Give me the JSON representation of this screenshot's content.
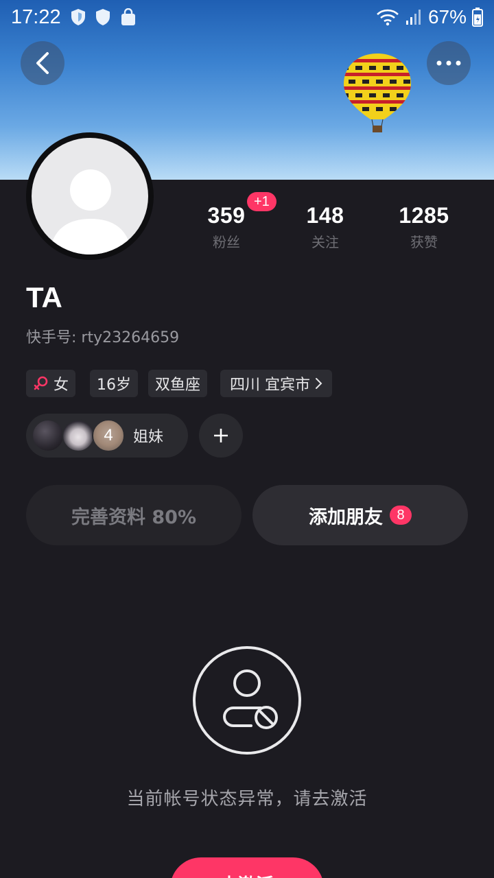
{
  "status_bar": {
    "time": "17:22",
    "battery_percent": "67%",
    "left_icons": [
      "shield-icon",
      "shield-icon",
      "shopping-bag-icon"
    ],
    "right_icons": [
      "wifi-icon",
      "signal-icon",
      "battery-icon"
    ]
  },
  "header": {
    "back_icon": "chevron-left-icon",
    "more_icon": "more-horizontal-icon"
  },
  "profile": {
    "name": "TA",
    "id_text": "快手号: rty23264659"
  },
  "stats": {
    "fans": {
      "value": "359",
      "label": "粉丝",
      "badge": "+1"
    },
    "following": {
      "value": "148",
      "label": "关注"
    },
    "likes": {
      "value": "1285",
      "label": "获赞"
    }
  },
  "tags": {
    "gender": "女",
    "age": "16岁",
    "zodiac": "双鱼座",
    "location": "四川 宜宾市"
  },
  "group": {
    "count": "4",
    "label": "姐妹"
  },
  "actions": {
    "complete_profile": "完善资料 80%",
    "add_friends": "添加朋友",
    "add_friends_badge": "8"
  },
  "empty_state": {
    "message": "当前帐号状态异常，请去激活",
    "button_label": "去激活"
  },
  "colors": {
    "accent": "#fe3666",
    "background": "#1c1b21"
  }
}
